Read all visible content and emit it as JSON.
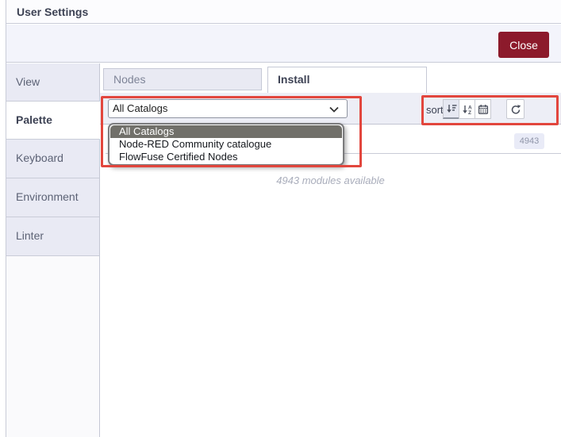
{
  "dialog": {
    "title": "User Settings",
    "close_button": "Close"
  },
  "sidebar": {
    "items": [
      {
        "label": "View",
        "active": false
      },
      {
        "label": "Palette",
        "active": true
      },
      {
        "label": "Keyboard",
        "active": false
      },
      {
        "label": "Environment",
        "active": false
      },
      {
        "label": "Linter",
        "active": false
      }
    ]
  },
  "tabs": [
    {
      "label": "Nodes",
      "active": false
    },
    {
      "label": "Install",
      "active": true
    }
  ],
  "toolbar": {
    "catalog_select": {
      "value": "All Catalogs",
      "dropdown_options": [
        {
          "label": "All Catalogs",
          "highlighted": true
        },
        {
          "label": "Node-RED Community catalogue",
          "highlighted": false
        },
        {
          "label": "FlowFuse Certified Nodes",
          "highlighted": false
        }
      ]
    },
    "sort_label": "sort:",
    "sort_buttons": [
      "sort-amount-down-icon",
      "sort-alpha-down-icon",
      "sort-date-icon"
    ],
    "refresh_button": "refresh-icon"
  },
  "search": {
    "count_badge": "4943"
  },
  "status_text": "4943 modules available",
  "annotations": {
    "count": 2,
    "color": "#e2463d",
    "targets": [
      "catalog-dropdown",
      "sort-controls"
    ]
  },
  "colors": {
    "close_button_bg": "#8c1a2b",
    "highlighted_option_bg": "#71706a",
    "panel_lavender": "#e9eaf4"
  }
}
